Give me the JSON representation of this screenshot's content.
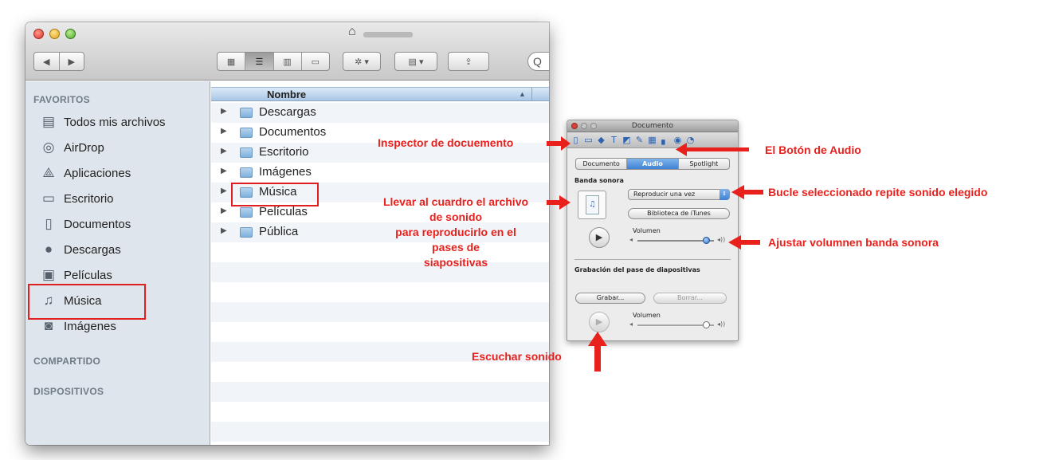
{
  "finder": {
    "sidebar": {
      "favorites_header": "FAVORITOS",
      "items": [
        {
          "label": "Todos mis archivos",
          "icon": "all-files-icon"
        },
        {
          "label": "AirDrop",
          "icon": "airdrop-icon"
        },
        {
          "label": "Aplicaciones",
          "icon": "applications-icon"
        },
        {
          "label": "Escritorio",
          "icon": "desktop-icon"
        },
        {
          "label": "Documentos",
          "icon": "documents-icon"
        },
        {
          "label": "Descargas",
          "icon": "downloads-icon"
        },
        {
          "label": "Películas",
          "icon": "movies-icon"
        },
        {
          "label": "Música",
          "icon": "music-icon"
        },
        {
          "label": "Imágenes",
          "icon": "pictures-icon"
        }
      ],
      "shared_header": "COMPARTIDO",
      "devices_header": "DISPOSITIVOS"
    },
    "list": {
      "column_header": "Nombre",
      "rows": [
        "Descargas",
        "Documentos",
        "Escritorio",
        "Imágenes",
        "Música",
        "Películas",
        "Pública"
      ]
    },
    "search_glyph": "Q"
  },
  "inspector": {
    "title": "Documento",
    "tabs": [
      "Documento",
      "Audio",
      "Spotlight"
    ],
    "active_tab": "Audio",
    "soundtrack_label": "Banda sonora",
    "repeat_popup": "Reproducir una vez",
    "itunes_button": "Biblioteca de iTunes",
    "volume_label": "Volumen",
    "recording_label": "Grabación del pase de diapositivas",
    "record_button": "Grabar...",
    "erase_button": "Borrar...",
    "recording_volume_label": "Volumen",
    "accent_color": "#3f82d5"
  },
  "annotations": {
    "inspector": "Inspector de docuemento",
    "audio_button": "El Botón de Audio",
    "drag_line1": "Llevar al cuardro el archivo",
    "drag_line2": "de sonido",
    "drag_line3": "para reproducirlo en el",
    "drag_line4": "pases de",
    "drag_line5": "siapositivas",
    "loop": "Bucle seleccionado repite sonido elegido",
    "volume": "Ajustar volumnen banda sonora",
    "listen": "Escuchar sonido",
    "color": "#e8211d"
  }
}
